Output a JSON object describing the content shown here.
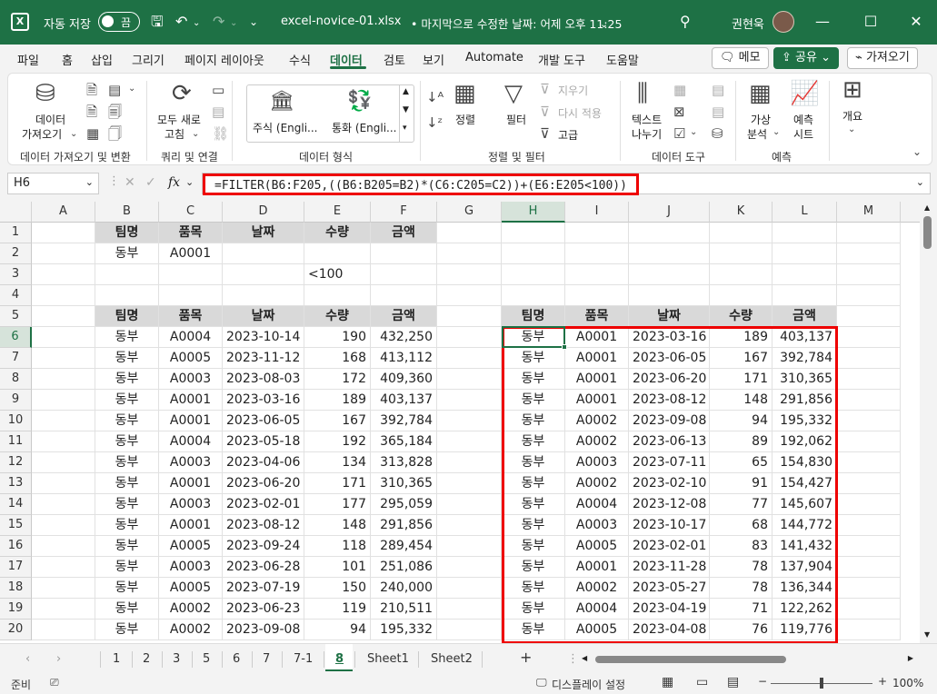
{
  "titlebar": {
    "app_icon": "X",
    "autosave_label": "자동 저장",
    "autosave_state": "끔",
    "filename": "excel-novice-01.xlsx",
    "modified": "• 마지막으로 수정한 날짜: 어제 오후 11:25",
    "user": "권현욱",
    "bg_color": "#1e7145"
  },
  "menu": {
    "tabs": [
      "파일",
      "홈",
      "삽입",
      "그리기",
      "페이지 레이아웃",
      "수식",
      "데이터",
      "검토",
      "보기",
      "Automate",
      "개발 도구",
      "도움말"
    ],
    "active_tab": "데이터",
    "memo": "메모",
    "share": "공유",
    "catchup": "가져오기"
  },
  "ribbon": {
    "get_data_1": "데이터",
    "get_data_2": "가져오기",
    "refresh_1": "모두 새로",
    "refresh_2": "고침",
    "stock": "주식 (Engli...",
    "currency": "통화 (Engli...",
    "sort": "정렬",
    "filter": "필터",
    "clear": "지우기",
    "reapply": "다시 적용",
    "advanced": "고급",
    "text_to_col_1": "텍스트",
    "text_to_col_2": "나누기",
    "whatif_1": "가상",
    "whatif_2": "분석",
    "forecast_1": "예측",
    "forecast_2": "시트",
    "outline": "개요",
    "groups": {
      "get_transform": "데이터 가져오기 및 변환",
      "queries": "쿼리 및 연결",
      "data_types": "데이터 형식",
      "sort_filter": "정렬 및 필터",
      "data_tools": "데이터 도구",
      "forecast": "예측"
    }
  },
  "formula_bar": {
    "name_box": "H6",
    "fx": "fx",
    "formula": "=FILTER(B6:F205,((B6:B205=B2)*(C6:C205=C2))+(E6:E205<100))"
  },
  "grid": {
    "columns": [
      "A",
      "B",
      "C",
      "D",
      "E",
      "F",
      "G",
      "H",
      "I",
      "J",
      "K",
      "L",
      "M"
    ],
    "rows": [
      "1",
      "2",
      "3",
      "4",
      "5",
      "6",
      "7",
      "8",
      "9",
      "10",
      "11",
      "12",
      "13",
      "14",
      "15",
      "16",
      "17",
      "18",
      "19",
      "20"
    ],
    "selected_col": "H",
    "selected_row": "6",
    "criteria_header": [
      "팀명",
      "품목",
      "날짜",
      "수량",
      "금액"
    ],
    "criteria_values": [
      "동부",
      "A0001"
    ],
    "criteria_qty": "<100",
    "source_header": [
      "팀명",
      "품목",
      "날짜",
      "수량",
      "금액"
    ],
    "source_rows": [
      [
        "동부",
        "A0004",
        "2023-10-14",
        "190",
        "432,250"
      ],
      [
        "동부",
        "A0005",
        "2023-11-12",
        "168",
        "413,112"
      ],
      [
        "동부",
        "A0003",
        "2023-08-03",
        "172",
        "409,360"
      ],
      [
        "동부",
        "A0001",
        "2023-03-16",
        "189",
        "403,137"
      ],
      [
        "동부",
        "A0001",
        "2023-06-05",
        "167",
        "392,784"
      ],
      [
        "동부",
        "A0004",
        "2023-05-18",
        "192",
        "365,184"
      ],
      [
        "동부",
        "A0003",
        "2023-04-06",
        "134",
        "313,828"
      ],
      [
        "동부",
        "A0001",
        "2023-06-20",
        "171",
        "310,365"
      ],
      [
        "동부",
        "A0003",
        "2023-02-01",
        "177",
        "295,059"
      ],
      [
        "동부",
        "A0001",
        "2023-08-12",
        "148",
        "291,856"
      ],
      [
        "동부",
        "A0005",
        "2023-09-24",
        "118",
        "289,454"
      ],
      [
        "동부",
        "A0003",
        "2023-06-28",
        "101",
        "251,086"
      ],
      [
        "동부",
        "A0005",
        "2023-07-19",
        "150",
        "240,000"
      ],
      [
        "동부",
        "A0002",
        "2023-06-23",
        "119",
        "210,511"
      ],
      [
        "동부",
        "A0002",
        "2023-09-08",
        "94",
        "195,332"
      ]
    ],
    "result_header": [
      "팀명",
      "품목",
      "날짜",
      "수량",
      "금액"
    ],
    "result_rows": [
      [
        "동부",
        "A0001",
        "2023-03-16",
        "189",
        "403,137"
      ],
      [
        "동부",
        "A0001",
        "2023-06-05",
        "167",
        "392,784"
      ],
      [
        "동부",
        "A0001",
        "2023-06-20",
        "171",
        "310,365"
      ],
      [
        "동부",
        "A0001",
        "2023-08-12",
        "148",
        "291,856"
      ],
      [
        "동부",
        "A0002",
        "2023-09-08",
        "94",
        "195,332"
      ],
      [
        "동부",
        "A0002",
        "2023-06-13",
        "89",
        "192,062"
      ],
      [
        "동부",
        "A0003",
        "2023-07-11",
        "65",
        "154,830"
      ],
      [
        "동부",
        "A0002",
        "2023-02-10",
        "91",
        "154,427"
      ],
      [
        "동부",
        "A0004",
        "2023-12-08",
        "77",
        "145,607"
      ],
      [
        "동부",
        "A0003",
        "2023-10-17",
        "68",
        "144,772"
      ],
      [
        "동부",
        "A0005",
        "2023-02-01",
        "83",
        "141,432"
      ],
      [
        "동부",
        "A0001",
        "2023-11-28",
        "78",
        "137,904"
      ],
      [
        "동부",
        "A0002",
        "2023-05-27",
        "78",
        "136,344"
      ],
      [
        "동부",
        "A0004",
        "2023-04-19",
        "71",
        "122,262"
      ],
      [
        "동부",
        "A0005",
        "2023-04-08",
        "76",
        "119,776"
      ]
    ]
  },
  "sheets": {
    "tabs": [
      "1",
      "2",
      "3",
      "5",
      "6",
      "7",
      "7-1",
      "8",
      "Sheet1",
      "Sheet2"
    ],
    "active": "8",
    "add": "+"
  },
  "status": {
    "ready": "준비",
    "display_settings": "디스플레이 설정",
    "zoom_minus": "−",
    "zoom_plus": "+",
    "zoom": "100%",
    "zoom_level": 1.0
  }
}
